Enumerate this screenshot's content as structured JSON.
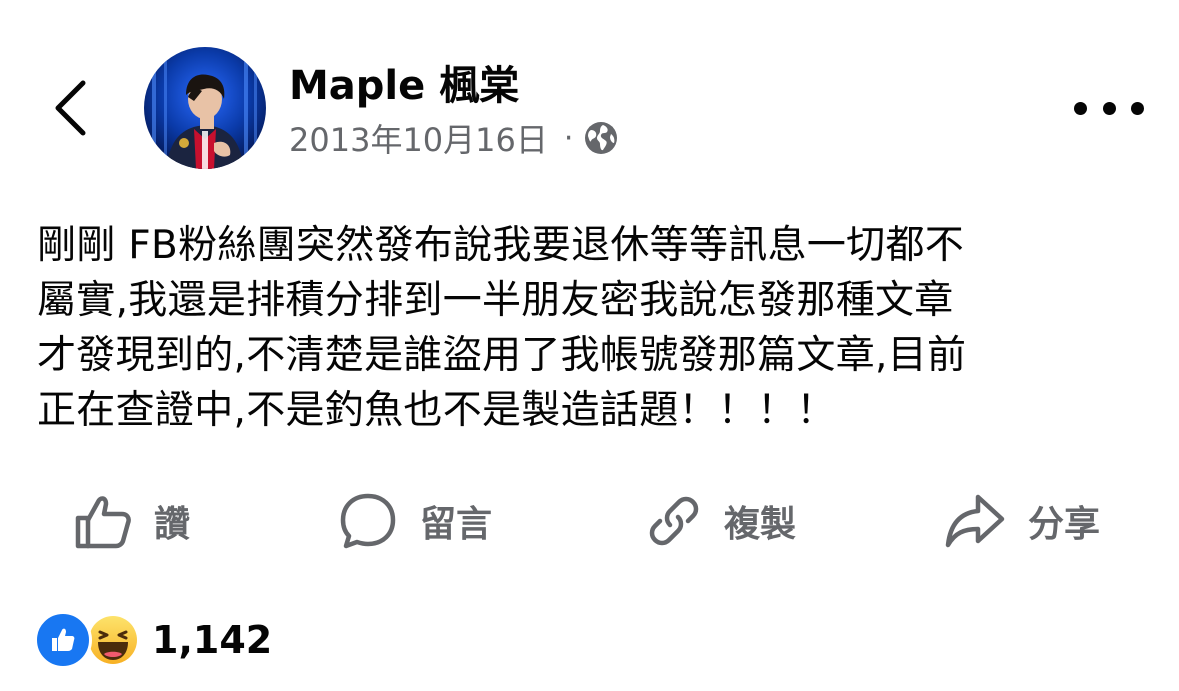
{
  "header": {
    "author_name": "Maple 楓棠",
    "date": "2013年10月16日",
    "separator": "·",
    "privacy_icon": "globe-icon",
    "back_icon": "chevron-left-icon",
    "more_icon": "more-horizontal-icon"
  },
  "post": {
    "lines": [
      "剛剛 FB粉絲團突然發布說我要退休等等訊息一切都不",
      "屬實,我還是排積分排到一半朋友密我說怎發那種文章",
      "才發現到的,不清楚是誰盜用了我帳號發那篇文章,目前",
      "正在查證中,不是釣魚也不是製造話題！！！！"
    ]
  },
  "actions": [
    {
      "label": "讚",
      "icon": "thumbs-up-icon"
    },
    {
      "label": "留言",
      "icon": "comment-icon"
    },
    {
      "label": "複製",
      "icon": "link-icon"
    },
    {
      "label": "分享",
      "icon": "share-icon"
    }
  ],
  "reactions": {
    "icons": [
      "like-reaction-icon",
      "haha-reaction-icon"
    ],
    "count": "1,142"
  },
  "colors": {
    "text_primary": "#050505",
    "text_secondary": "#65676b",
    "like_blue": "#1877f2",
    "haha_yellow": "#f7b125"
  }
}
